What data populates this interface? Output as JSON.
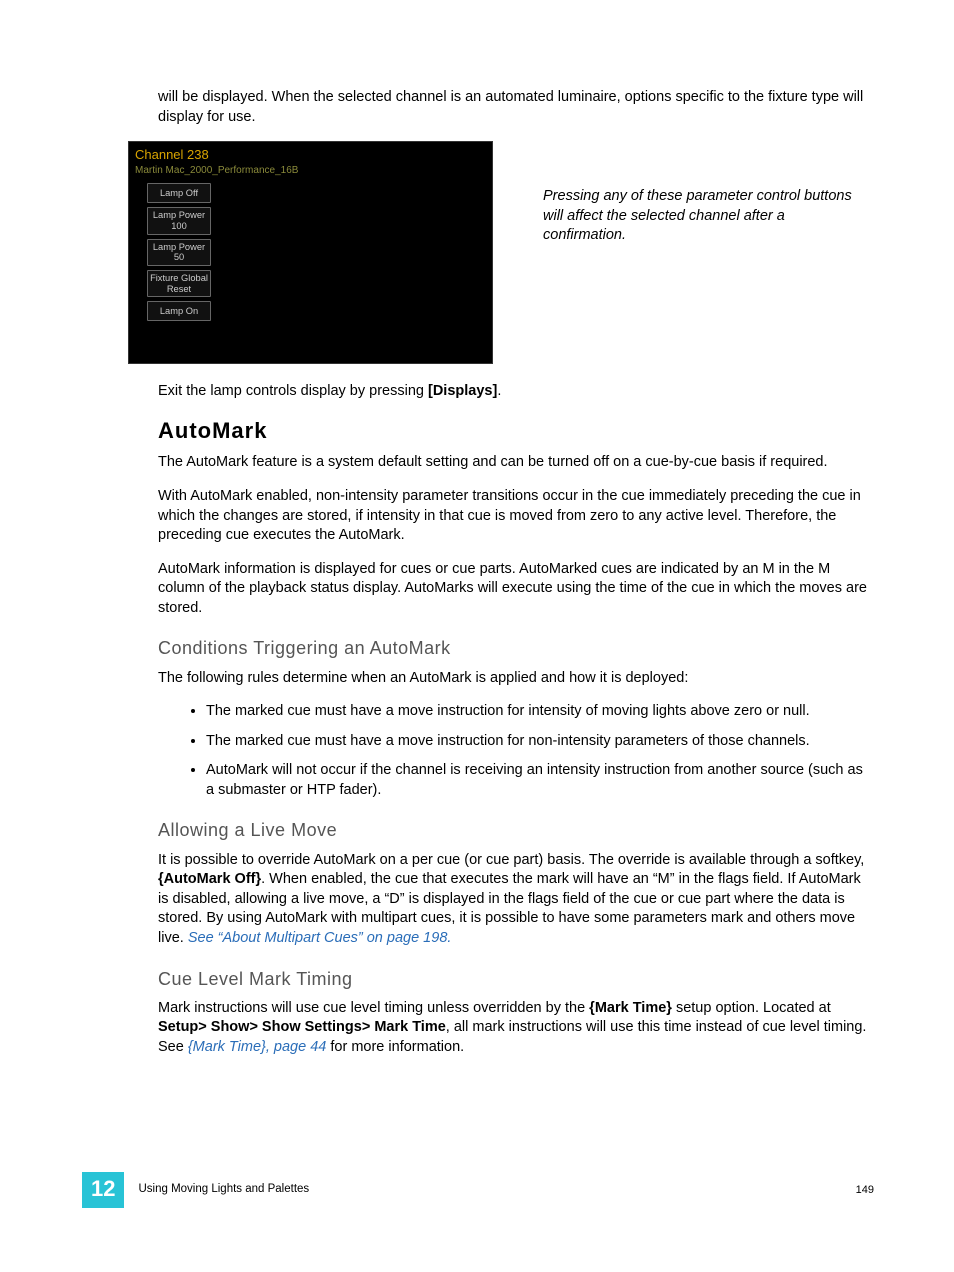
{
  "intro_para": "will be displayed. When the selected channel is an automated luminaire, options specific to the fixture type will display for use.",
  "screenshot": {
    "channel": "Channel 238",
    "fixture": "Martin Mac_2000_Performance_16B",
    "buttons": [
      "Lamp Off",
      "Lamp Power 100",
      "Lamp Power 50",
      "Fixture Global Reset",
      "Lamp On"
    ]
  },
  "caption": "Pressing any of these parameter control buttons will affect the selected channel after a confirmation.",
  "exit_line_pre": "Exit the lamp controls display by pressing ",
  "exit_line_bold": "[Displays]",
  "exit_line_post": ".",
  "automark": {
    "title": "AutoMark",
    "p1": "The AutoMark feature is a system default setting and can be turned off on a cue-by-cue basis if required.",
    "p2": "With AutoMark enabled, non-intensity parameter transitions occur in the cue immediately preceding the cue in which the changes are stored, if intensity in that cue is moved from zero to any active level. Therefore, the preceding cue executes the AutoMark.",
    "p3": "AutoMark information is displayed for cues or cue parts. AutoMarked cues are indicated by an M in the M column of the playback status display. AutoMarks will execute using the time of the cue in which the moves are stored."
  },
  "conditions": {
    "title": "Conditions Triggering an AutoMark",
    "intro": "The following rules determine when an AutoMark is applied and how it is deployed:",
    "items": [
      "The marked cue must have a move instruction for intensity of moving lights above zero or null.",
      "The marked cue must have a move instruction for non-intensity parameters of those channels.",
      "AutoMark will not occur if the channel is receiving an intensity instruction from another source (such as a submaster or HTP fader)."
    ]
  },
  "allowing": {
    "title": "Allowing a Live Move",
    "p_pre": "It is possible to override AutoMark on a per cue (or cue part) basis. The override is available through a softkey, ",
    "p_bold": "{AutoMark Off}",
    "p_mid": ". When enabled, the cue that executes the mark will have an “M” in the flags field. If AutoMark is disabled, allowing a live move, a “D” is displayed in the flags field of the cue or cue part where the data is stored. By using AutoMark with multipart cues, it is possible to have some parameters mark and others move live. ",
    "p_link": "See “About Multipart Cues” on page 198."
  },
  "cuelevel": {
    "title": "Cue Level Mark Timing",
    "p_pre": "Mark instructions will use cue level timing unless overridden by the ",
    "p_bold1": "{Mark Time}",
    "p_mid1": " setup option. Located at ",
    "p_bold2": "Setup> Show> Show Settings> Mark Time",
    "p_mid2": ", all mark instructions will use this time instead of cue level timing. See ",
    "p_link": "{Mark Time}, page 44",
    "p_post": " for more information."
  },
  "footer": {
    "chapter_num": "12",
    "chapter_title": "Using Moving Lights and Palettes",
    "page_num": "149"
  }
}
